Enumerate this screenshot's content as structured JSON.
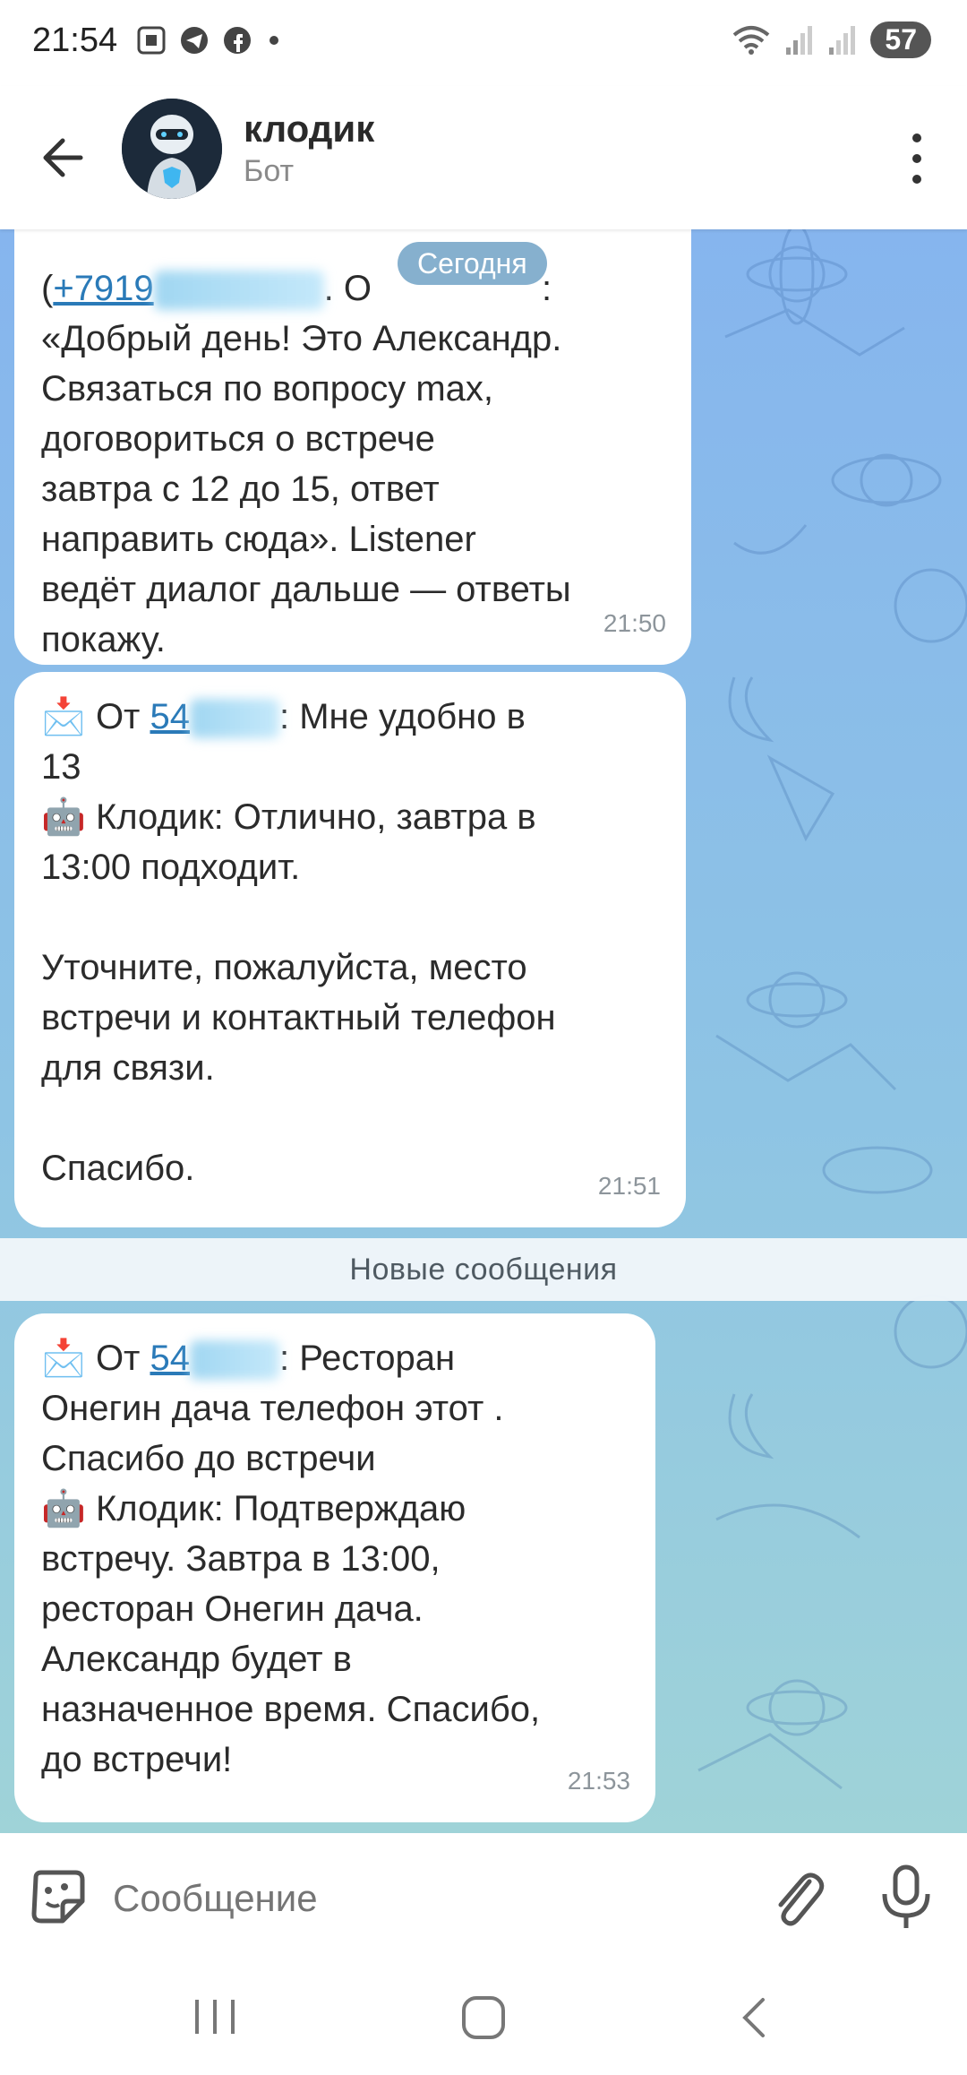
{
  "status_bar": {
    "time": "21:54",
    "battery": "57",
    "left_icons": [
      "screenshot-icon",
      "telegram-icon",
      "facebook-icon",
      "dot-icon"
    ],
    "right_icons": [
      "wifi-icon",
      "signal-icon",
      "signal-icon"
    ]
  },
  "header": {
    "title": "клодик",
    "subtitle": "Бот"
  },
  "chat": {
    "date_label": "Сегодня",
    "new_messages_label": "Новые сообщения",
    "messages": [
      {
        "lines": [
          "(+7919",
          "«Добрый день! Это Александр.",
          "Связаться по вопросу max,",
          "договориться о встрече",
          "завтра с 12 до 15, ответ",
          "направить сюда». Listener",
          "ведёт диалог дальше — ответы",
          "покажу."
        ],
        "line1_link": "+7919",
        "line1_tail": ". О",
        "line1_end": ":",
        "time": "21:50"
      },
      {
        "from_prefix": "От ",
        "from_link": "54",
        "from_tail": ": Мне удобно в",
        "line2": "13",
        "bot_line": "Клодик: Отлично, завтра в",
        "line4": "13:00 подходит.",
        "line6": "Уточните, пожалуйста, место",
        "line7": "встречи и контактный телефон",
        "line8": "для связи.",
        "line10": "Спасибо.",
        "time": "21:51"
      },
      {
        "from_prefix": "От ",
        "from_link": "54",
        "from_tail": ": Ресторан",
        "line2": "Онегин дача телефон этот .",
        "line3": "Спасибо до встречи",
        "bot_line": "Клодик: Подтверждаю",
        "line5": "встречу. Завтра в 13:00,",
        "line6": "ресторан Онегин дача.",
        "line7": "Александр будет в",
        "line8": "назначенное время. Спасибо,",
        "line9": "до встречи!",
        "time": "21:53"
      }
    ]
  },
  "input": {
    "placeholder": "Сообщение"
  },
  "colors": {
    "link": "#2a7ab8",
    "chat_bg_top": "#86b5ee",
    "chat_bg_bottom": "#9fd3d8",
    "date_pill": "#5e96be"
  }
}
